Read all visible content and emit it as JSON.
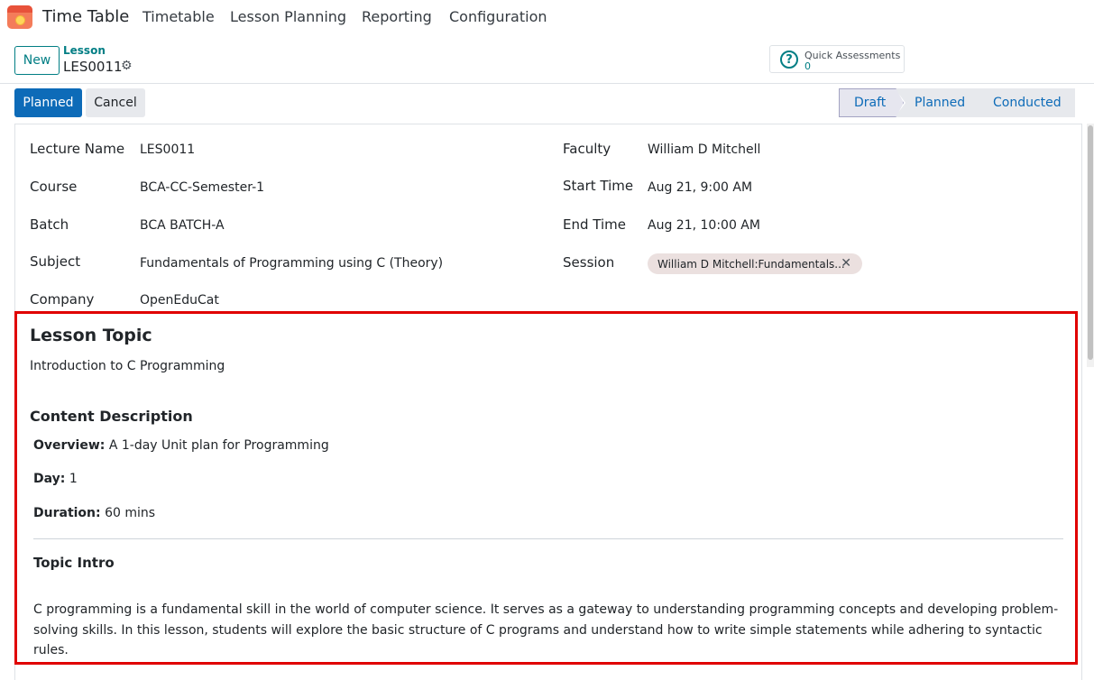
{
  "nav": {
    "brand": "Time Table",
    "menu": [
      "Timetable",
      "Lesson Planning",
      "Reporting",
      "Configuration"
    ]
  },
  "control": {
    "new_label": "New",
    "breadcrumb_parent": "Lesson",
    "breadcrumb_current": "LES0011",
    "smart_button": {
      "title": "Quick Assessments",
      "value": "0"
    }
  },
  "statusbar": {
    "planned_label": "Planned",
    "cancel_label": "Cancel",
    "stages": [
      "Draft",
      "Planned",
      "Conducted"
    ],
    "active_stage": "Draft"
  },
  "form": {
    "left": [
      {
        "label": "Lecture Name",
        "value": "LES0011"
      },
      {
        "label": "Course",
        "value": "BCA-CC-Semester-1"
      },
      {
        "label": "Batch",
        "value": "BCA BATCH-A"
      },
      {
        "label": "Subject",
        "value": "Fundamentals of Programming using C (Theory)"
      },
      {
        "label": "Company",
        "value": "OpenEduCat"
      }
    ],
    "right": [
      {
        "label": "Faculty",
        "value": "William D Mitchell"
      },
      {
        "label": "Start Time",
        "value": "Aug 21, 9:00 AM"
      },
      {
        "label": "End Time",
        "value": "Aug 21, 10:00 AM"
      },
      {
        "label": "Session",
        "value": "William D Mitchell:Fundamentals..."
      }
    ]
  },
  "lesson": {
    "topic_heading": "Lesson Topic",
    "topic_value": "Introduction to C Programming",
    "content_heading": "Content Description",
    "overview_label": "Overview:",
    "overview_value": "A 1-day Unit plan for Programming",
    "day_label": "Day:",
    "day_value": "1",
    "duration_label": "Duration:",
    "duration_value": "60 mins",
    "intro_heading": "Topic Intro",
    "intro_text": "C programming is a fundamental skill in the world of computer science. It serves as a gateway to understanding programming concepts and developing problem-solving skills. In this lesson, students will explore the basic structure of C programs and understand how to write simple statements while adhering to syntactic rules."
  },
  "colors": {
    "accent": "#017e84",
    "primary": "#0d6bb8",
    "highlight_border": "#e00000",
    "tag_bg": "#ebe0df"
  },
  "icons": {
    "app": "timetable-app-icon",
    "gear": "gear-icon",
    "question": "question-circle-icon",
    "tag_remove": "close-icon"
  }
}
